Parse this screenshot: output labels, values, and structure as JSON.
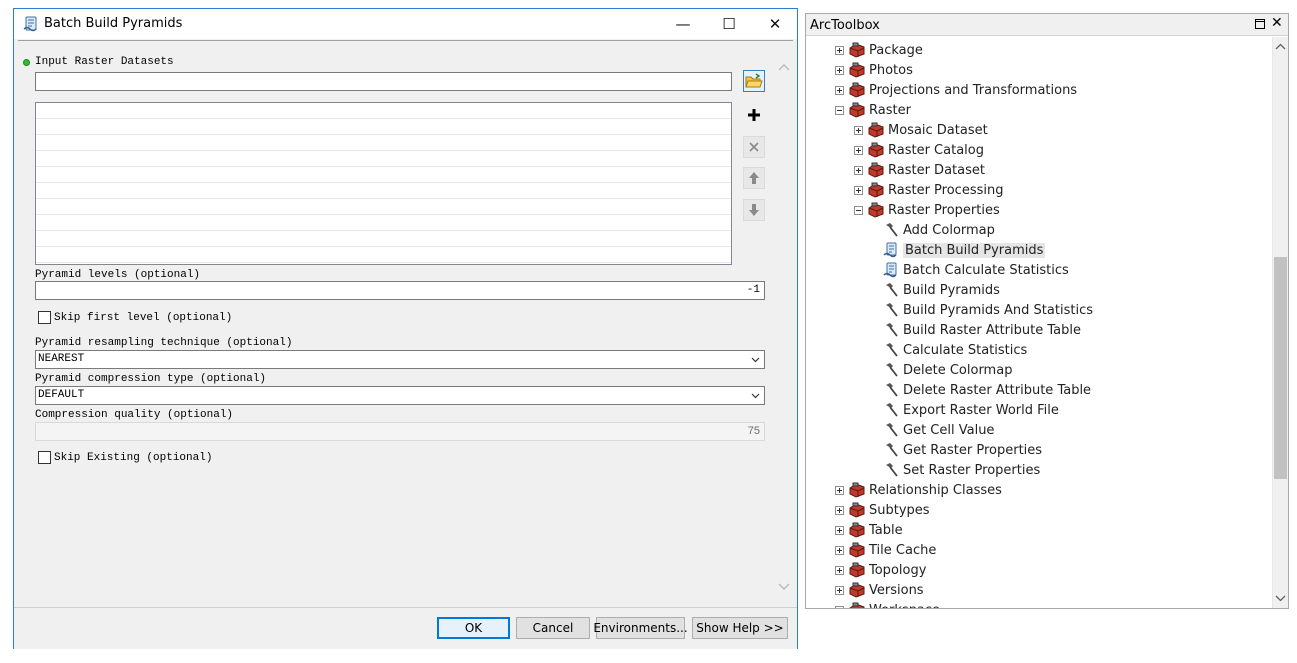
{
  "dialog": {
    "title": "Batch Build Pyramids",
    "window_controls": {
      "minimize": "—",
      "maximize": "☐",
      "close": "✕"
    },
    "input_raster_label": "Input Raster Datasets",
    "input_raster_value": "",
    "pyramid_levels_label": "Pyramid levels (optional)",
    "pyramid_levels_value": "-1",
    "skip_first_level_label": "Skip first level (optional)",
    "skip_first_level_checked": false,
    "resampling_label": "Pyramid resampling technique (optional)",
    "resampling_value": "NEAREST",
    "compression_type_label": "Pyramid compression type (optional)",
    "compression_type_value": "DEFAULT",
    "compression_quality_label": "Compression quality (optional)",
    "compression_quality_value": "75",
    "skip_existing_label": "Skip Existing (optional)",
    "skip_existing_checked": false,
    "buttons": {
      "ok": "OK",
      "cancel": "Cancel",
      "environments": "Environments...",
      "help": "Show Help >>"
    }
  },
  "toolbox": {
    "title": "ArcToolbox",
    "close_glyph": "✕",
    "selected_item": "Batch Build Pyramids",
    "items": [
      {
        "label": "Package",
        "kind": "toolbox",
        "level": 0,
        "expander": "plus"
      },
      {
        "label": "Photos",
        "kind": "toolbox",
        "level": 0,
        "expander": "plus"
      },
      {
        "label": "Projections and Transformations",
        "kind": "toolbox",
        "level": 0,
        "expander": "plus"
      },
      {
        "label": "Raster",
        "kind": "toolbox",
        "level": 0,
        "expander": "minus"
      },
      {
        "label": "Mosaic Dataset",
        "kind": "toolbox",
        "level": 1,
        "expander": "plus"
      },
      {
        "label": "Raster Catalog",
        "kind": "toolbox",
        "level": 1,
        "expander": "plus"
      },
      {
        "label": "Raster Dataset",
        "kind": "toolbox",
        "level": 1,
        "expander": "plus"
      },
      {
        "label": "Raster Processing",
        "kind": "toolbox",
        "level": 1,
        "expander": "plus"
      },
      {
        "label": "Raster Properties",
        "kind": "toolbox",
        "level": 1,
        "expander": "minus"
      },
      {
        "label": "Add Colormap",
        "kind": "tool",
        "level": 2
      },
      {
        "label": "Batch Build Pyramids",
        "kind": "script",
        "level": 2
      },
      {
        "label": "Batch Calculate Statistics",
        "kind": "script",
        "level": 2
      },
      {
        "label": "Build Pyramids",
        "kind": "tool",
        "level": 2
      },
      {
        "label": "Build Pyramids And Statistics",
        "kind": "tool",
        "level": 2
      },
      {
        "label": "Build Raster Attribute Table",
        "kind": "tool",
        "level": 2
      },
      {
        "label": "Calculate Statistics",
        "kind": "tool",
        "level": 2
      },
      {
        "label": "Delete Colormap",
        "kind": "tool",
        "level": 2
      },
      {
        "label": "Delete Raster Attribute Table",
        "kind": "tool",
        "level": 2
      },
      {
        "label": "Export Raster World File",
        "kind": "tool",
        "level": 2
      },
      {
        "label": "Get Cell Value",
        "kind": "tool",
        "level": 2
      },
      {
        "label": "Get Raster Properties",
        "kind": "tool",
        "level": 2
      },
      {
        "label": "Set Raster Properties",
        "kind": "tool",
        "level": 2
      },
      {
        "label": "Relationship Classes",
        "kind": "toolbox",
        "level": 0,
        "expander": "plus"
      },
      {
        "label": "Subtypes",
        "kind": "toolbox",
        "level": 0,
        "expander": "plus"
      },
      {
        "label": "Table",
        "kind": "toolbox",
        "level": 0,
        "expander": "plus"
      },
      {
        "label": "Tile Cache",
        "kind": "toolbox",
        "level": 0,
        "expander": "plus"
      },
      {
        "label": "Topology",
        "kind": "toolbox",
        "level": 0,
        "expander": "plus"
      },
      {
        "label": "Versions",
        "kind": "toolbox",
        "level": 0,
        "expander": "plus"
      },
      {
        "label": "Workspace",
        "kind": "toolbox",
        "level": 0,
        "expander": "plus"
      }
    ]
  },
  "colors": {
    "accent": "#0078d7",
    "window_border": "#2b7cd3",
    "required_dot": "#2bbf2b",
    "toolbox_red": "#c0392b"
  }
}
